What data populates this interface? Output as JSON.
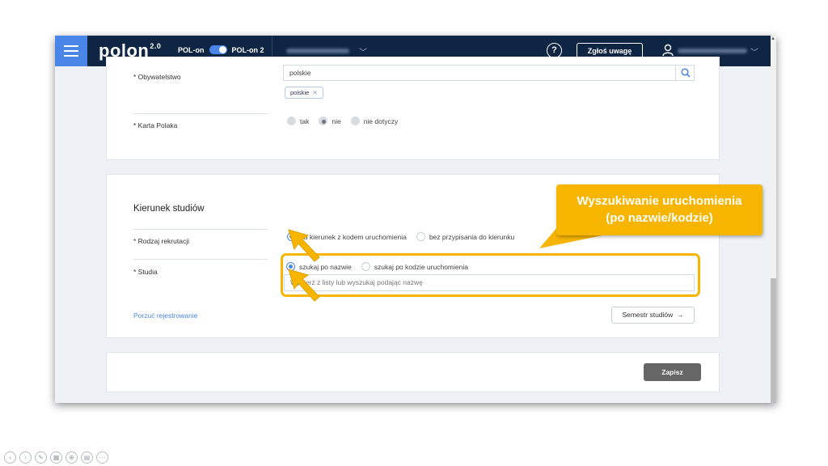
{
  "topbar": {
    "logo": "polon",
    "logo_version": "2.0",
    "switch_left": "POL-on",
    "switch_right": "POL-on 2",
    "help_symbol": "?",
    "report_button": "Zgłoś uwagę"
  },
  "personal": {
    "citizenship_label": "* Obywatelstwo",
    "citizenship_value": "polskie",
    "citizenship_chip": "polskie",
    "karta_label": "* Karta Polaka",
    "karta_options": [
      "tak",
      "nie",
      "nie dotyczy"
    ],
    "karta_selected": "nie"
  },
  "study": {
    "section_title": "Kierunek studiów",
    "recruitment_label": "* Rodzaj rekrutacji",
    "recruitment_options": [
      "na kierunek z kodem uruchomienia",
      "bez przypisania do kierunku"
    ],
    "recruitment_selected": "na kierunek z kodem uruchomienia",
    "studies_label": "* Studia",
    "studies_options": [
      "szukaj po nazwie",
      "szukaj po kodzie uruchomienia"
    ],
    "studies_selected": "szukaj po nazwie",
    "studies_placeholder": "Wybierz z listy lub wyszukaj podając nazwę",
    "abandon_link": "Porzuć rejestrowanie",
    "next_button": "Semestr studiów",
    "next_arrow": "→"
  },
  "footer": {
    "save_button": "Zapisz"
  },
  "callout": {
    "line1": "Wyszukiwanie uruchomienia",
    "line2": "(po nazwie/kodzie)"
  },
  "colors": {
    "topbar": "#0f2544",
    "accent": "#4a86e8",
    "highlight": "#f7b500"
  }
}
